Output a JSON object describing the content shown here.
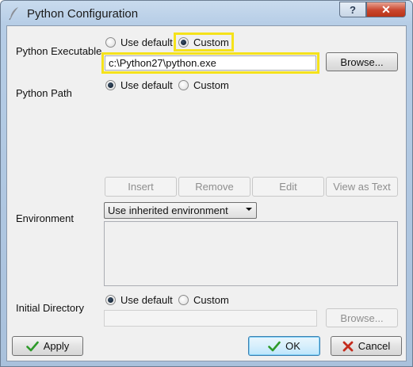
{
  "window": {
    "title": "Python Configuration",
    "help_label": "?",
    "close_label": "✕",
    "app_icon": "feather-icon"
  },
  "python_executable": {
    "label": "Python Executable",
    "option_default": "Use default",
    "option_custom": "Custom",
    "selected": "Custom",
    "path_value": "c:\\Python27\\python.exe",
    "browse_label": "Browse..."
  },
  "python_path": {
    "label": "Python Path",
    "option_default": "Use default",
    "option_custom": "Custom",
    "selected": "Use default",
    "buttons": {
      "insert": "Insert",
      "remove": "Remove",
      "edit": "Edit",
      "view_as_text": "View as Text"
    }
  },
  "environment": {
    "label": "Environment",
    "selected_option": "Use inherited environment"
  },
  "initial_directory": {
    "label": "Initial Directory",
    "option_default": "Use default",
    "option_custom": "Custom",
    "selected": "Use default",
    "path_value": "",
    "browse_label": "Browse..."
  },
  "footer": {
    "apply_label": "Apply",
    "ok_label": "OK",
    "cancel_label": "Cancel"
  },
  "colors": {
    "highlight": "#f5e21b",
    "check_green": "#2e9a2a",
    "cancel_red": "#c42b1c"
  }
}
